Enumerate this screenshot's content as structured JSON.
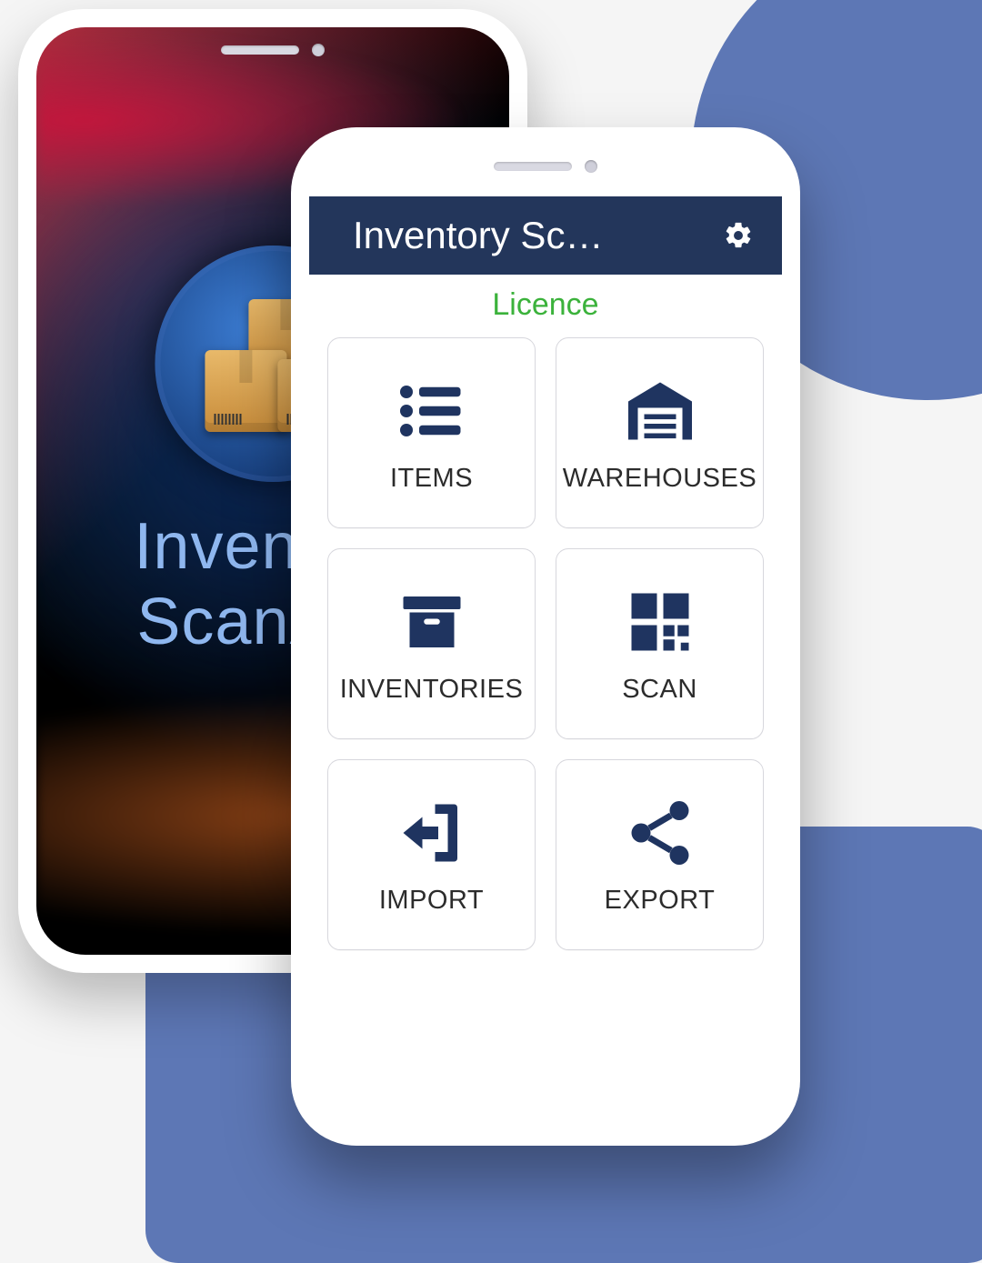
{
  "splash": {
    "title": "Inventory\nScanApp"
  },
  "header": {
    "title": "Inventory Sc…"
  },
  "licence": {
    "label": "Licence"
  },
  "tiles": {
    "items": "ITEMS",
    "warehouses": "WAREHOUSES",
    "inventories": "INVENTORIES",
    "scan": "SCAN",
    "import": "IMPORT",
    "export": "EXPORT"
  },
  "colors": {
    "brand_dark": "#23365b",
    "accent_green": "#3bb23b",
    "bg_blue": "#5d77b5"
  }
}
